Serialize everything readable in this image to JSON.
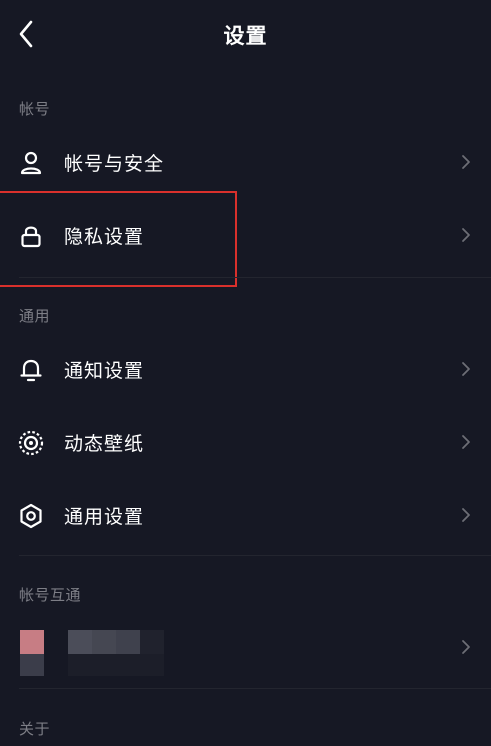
{
  "header": {
    "title": "设置",
    "back_icon": "chevron-left-icon"
  },
  "sections": {
    "account": {
      "label": "帐号",
      "items": [
        {
          "label": "帐号与安全",
          "icon": "user-icon"
        },
        {
          "label": "隐私设置",
          "icon": "lock-icon"
        }
      ]
    },
    "general": {
      "label": "通用",
      "items": [
        {
          "label": "通知设置",
          "icon": "bell-icon"
        },
        {
          "label": "动态壁纸",
          "icon": "live-wallpaper-icon"
        },
        {
          "label": "通用设置",
          "icon": "gear-icon"
        }
      ]
    },
    "linked": {
      "label": "帐号互通"
    },
    "about": {
      "label": "关于"
    }
  },
  "colors": {
    "background": "#161824",
    "text": "#ffffff",
    "secondary_text": "#7d7e86",
    "chevron": "#6d6e76",
    "highlight": "#d9302c"
  }
}
